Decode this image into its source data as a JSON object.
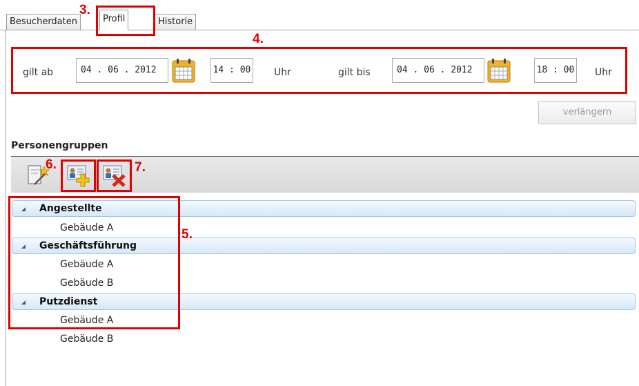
{
  "tabs": [
    {
      "label": "Besucherdaten"
    },
    {
      "label": "Profil"
    },
    {
      "label": "Historie"
    }
  ],
  "annotations": {
    "a3": "3.",
    "a4": "4.",
    "a5": "5.",
    "a6": "6.",
    "a7": "7."
  },
  "validity": {
    "from_label": "gilt ab",
    "from_date": "04 . 06 . 2012",
    "from_time": "14 : 00",
    "from_unit": "Uhr",
    "to_label": "gilt bis",
    "to_date": "04 . 06 . 2012",
    "to_time": "18 : 00",
    "to_unit": "Uhr"
  },
  "extend_button": "verlängern",
  "person_groups": {
    "title": "Personengruppen",
    "groups": [
      {
        "name": "Angestellte",
        "children": [
          "Gebäude A"
        ]
      },
      {
        "name": "Geschäftsführung",
        "children": [
          "Gebäude A",
          "Gebäude B"
        ]
      },
      {
        "name": "Putzdienst",
        "children": [
          "Gebäude A",
          "Gebäude B"
        ]
      }
    ]
  },
  "icons": {
    "calendar": "calendar-icon",
    "wizard": "wizard-icon",
    "add_group": "add-group-icon",
    "remove_group": "remove-group-icon",
    "expand": "expand-triangle-icon"
  },
  "colors": {
    "annotation": "#e10000",
    "group_bar": "#d6e8f8",
    "calendar": "#f0b020"
  }
}
